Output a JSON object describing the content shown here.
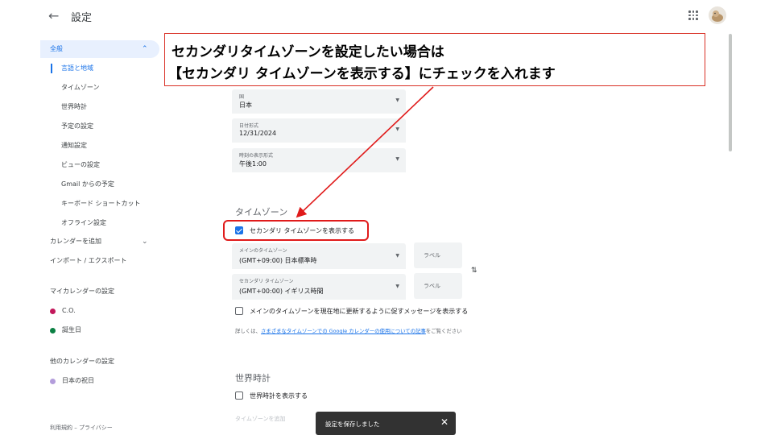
{
  "header": {
    "title": "設定"
  },
  "sidebar": {
    "general": "全般",
    "items": [
      "言語と地域",
      "タイムゾーン",
      "世界時計",
      "予定の設定",
      "通知設定",
      "ビューの設定",
      "Gmail からの予定",
      "キーボード ショートカット",
      "オフライン設定"
    ],
    "add_calendar": "カレンダーを追加",
    "import_export": "インポート / エクスポート",
    "my_calendars_title": "マイカレンダーの設定",
    "my_calendars": [
      {
        "name": "C.O.",
        "color": "#c2185b"
      },
      {
        "name": "誕生日",
        "color": "#0b8043"
      }
    ],
    "other_calendars_title": "他のカレンダーの設定",
    "other_calendars": [
      {
        "name": "日本の祝日",
        "color": "#b39ddb"
      }
    ],
    "footer": "利用規約 – プライバシー"
  },
  "region": {
    "country_label": "国",
    "country_value": "日本",
    "date_format_label": "日付形式",
    "date_format_value": "12/31/2024",
    "time_format_label": "時刻の表示形式",
    "time_format_value": "午後1:00"
  },
  "timezone": {
    "section_title": "タイムゾーン",
    "secondary_checkbox_label": "セカンダリ タイムゾーンを表示する",
    "secondary_checked": true,
    "primary_label": "メインのタイムゾーン",
    "primary_value": "(GMT+09:00) 日本標準時",
    "primary_tag_placeholder": "ラベル",
    "secondary_label": "セカンダリ タイムゾーン",
    "secondary_value": "(GMT+00:00) イギリス時間",
    "secondary_tag_placeholder": "ラベル",
    "update_prompt_label": "メインのタイムゾーンを現在地に更新するように促すメッセージを表示する",
    "help_prefix": "詳しくは、",
    "help_link": "さまざまなタイムゾーンでの Google カレンダーの使用についての記事",
    "help_suffix": "をご覧ください"
  },
  "world_clock": {
    "section_title": "世界時計",
    "checkbox_label": "世界時計を表示する",
    "add_timezone": "タイムゾーンを追加"
  },
  "snackbar": {
    "message": "設定を保存しました"
  },
  "annotation": {
    "line1": "セカンダリタイムゾーンを設定したい場合は",
    "line2": "【セカンダリ タイムゾーンを表示する】にチェックを入れます",
    "color": "#e01b1b"
  }
}
